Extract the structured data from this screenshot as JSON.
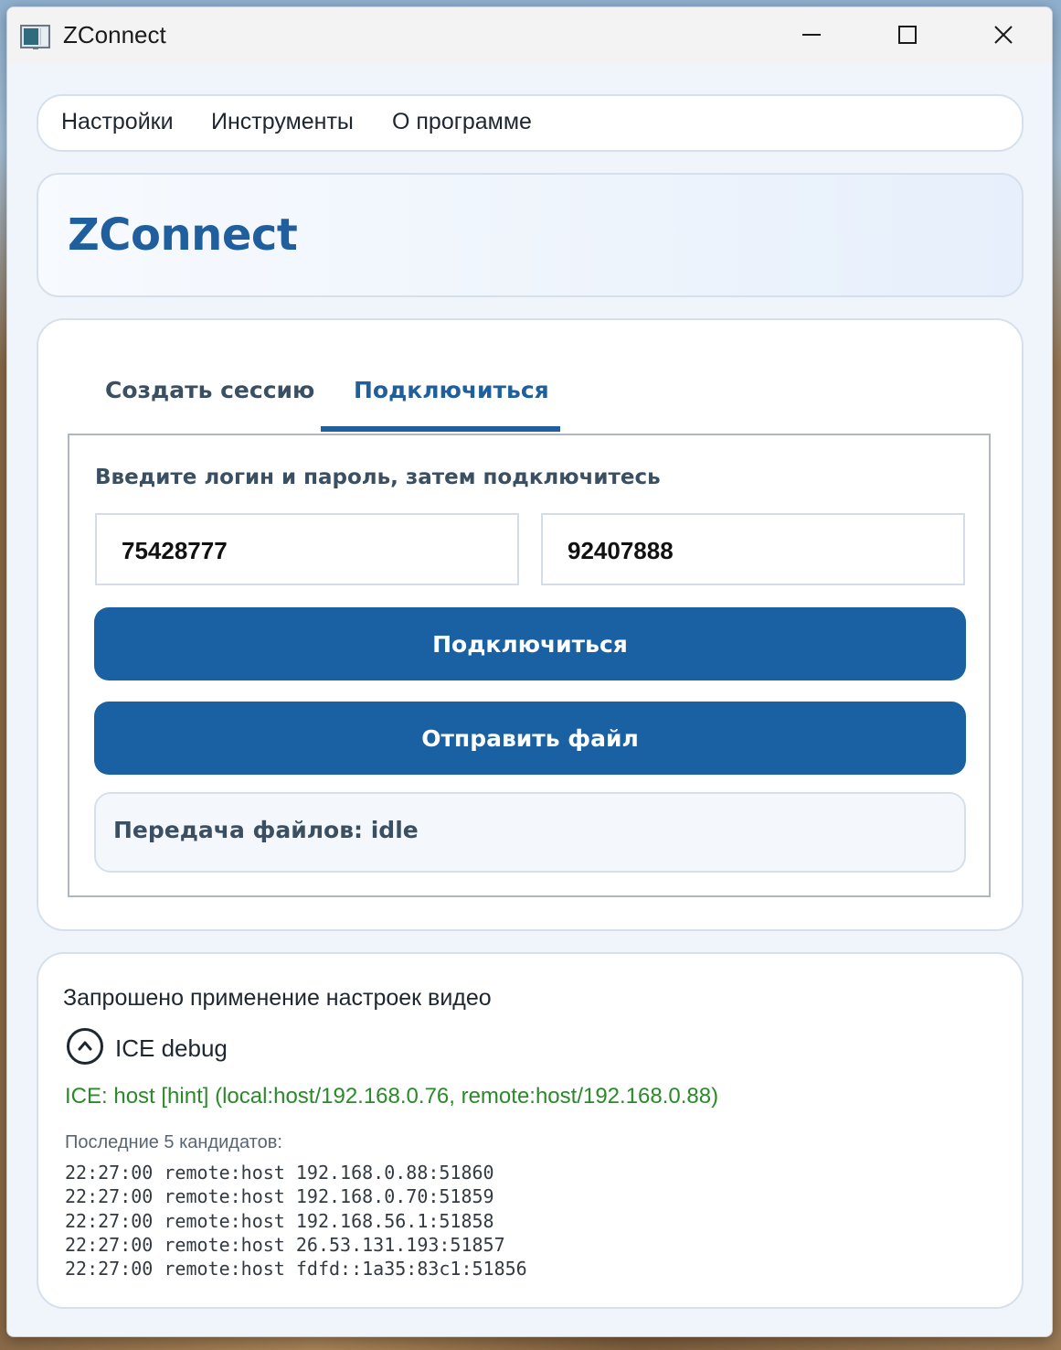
{
  "window": {
    "title": "ZConnect"
  },
  "menu": {
    "items": [
      {
        "label": "Настройки"
      },
      {
        "label": "Инструменты"
      },
      {
        "label": "О программе"
      }
    ]
  },
  "header": {
    "title": "ZConnect"
  },
  "tabs": [
    {
      "label": "Создать сессию",
      "active": false
    },
    {
      "label": "Подключиться",
      "active": true
    }
  ],
  "connect": {
    "instruction": "Введите логин и пароль, затем подключитесь",
    "login_value": "75428777",
    "password_value": "92407888",
    "connect_button": "Подключиться",
    "send_file_button": "Отправить файл",
    "file_transfer_status": "Передача файлов: idle"
  },
  "log": {
    "message": "Запрошено применение настроек видео",
    "ice_label": "ICE debug",
    "ice_status": "ICE: host [hint] (local:host/192.168.0.76, remote:host/192.168.0.88)",
    "candidates_title": "Последние 5 кандидатов:",
    "candidates": [
      "22:27:00 remote:host 192.168.0.88:51860",
      "22:27:00 remote:host 192.168.0.70:51859",
      "22:27:00 remote:host 192.168.56.1:51858",
      "22:27:00 remote:host 26.53.131.193:51857",
      "22:27:00 remote:host fdfd::1a35:83c1:51856"
    ]
  },
  "colors": {
    "accent": "#1a61a3",
    "ice_status": "#2a8a2a"
  },
  "icons": [
    "app-icon",
    "minimize-icon",
    "maximize-icon",
    "close-icon",
    "chevron-up-icon"
  ]
}
